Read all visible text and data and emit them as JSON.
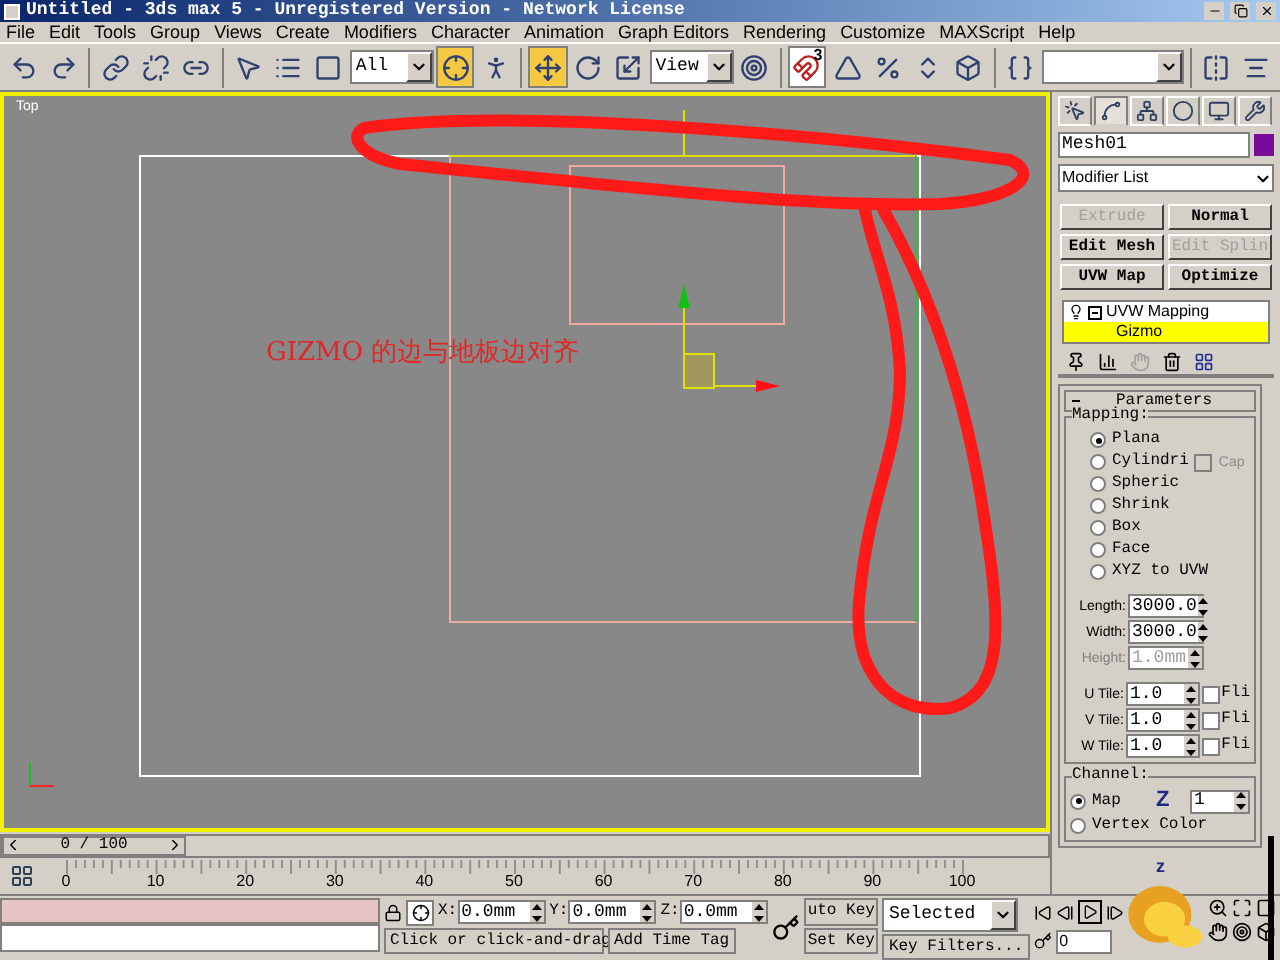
{
  "window": {
    "title": "Untitled - 3ds max 5 - Unregistered Version - Network License"
  },
  "menu": [
    "File",
    "Edit",
    "Tools",
    "Group",
    "Views",
    "Create",
    "Modifiers",
    "Character",
    "Animation",
    "Graph Editors",
    "Rendering",
    "Customize",
    "MAXScript",
    "Help"
  ],
  "toolbar": [
    {
      "kind": "button",
      "selected": false
    },
    {
      "kind": "button",
      "selected": false
    },
    {
      "kind": "sep"
    },
    {
      "kind": "button",
      "selected": false
    },
    {
      "kind": "button",
      "selected": false
    },
    {
      "kind": "button",
      "selected": false
    },
    {
      "kind": "sep"
    },
    {
      "kind": "button",
      "selected": false
    },
    {
      "kind": "button",
      "selected": false
    },
    {
      "kind": "button",
      "selected": false
    },
    {
      "kind": "dropdown",
      "value": "All"
    },
    {
      "kind": "button",
      "selected": true
    },
    {
      "kind": "button",
      "selected": false
    },
    {
      "kind": "sep"
    },
    {
      "kind": "button",
      "selected": true
    },
    {
      "kind": "button",
      "selected": false
    },
    {
      "kind": "button",
      "selected": false
    },
    {
      "kind": "dropdown",
      "value": "View"
    },
    {
      "kind": "button",
      "selected": false
    },
    {
      "kind": "sep"
    },
    {
      "kind": "button",
      "selected": true,
      "badge": "3"
    },
    {
      "kind": "button",
      "selected": false
    },
    {
      "kind": "button",
      "selected": false
    },
    {
      "kind": "button",
      "selected": false
    },
    {
      "kind": "button",
      "selected": false
    },
    {
      "kind": "sep"
    },
    {
      "kind": "button",
      "selected": false
    },
    {
      "kind": "dropdown"
    },
    {
      "kind": "sep"
    },
    {
      "kind": "button",
      "selected": false
    },
    {
      "kind": "button",
      "selected": false
    }
  ],
  "viewport": {
    "label": "Top",
    "annotation": "GIZMO 的边与地板边对齐"
  },
  "time_slider": {
    "position": "0 / 100",
    "level": 0
  },
  "ruler": [
    "0",
    "10",
    "20",
    "30",
    "40",
    "50",
    "60",
    "70",
    "80",
    "90",
    "100"
  ],
  "command_panel": {
    "tabs": [
      {
        "selected": false
      },
      {
        "selected": true
      },
      {
        "selected": false
      },
      {
        "selected": false
      },
      {
        "selected": false
      },
      {
        "selected": false
      }
    ],
    "object_name": "Mesh01",
    "modifier_list": "Modifier List",
    "modifier_buttons": [
      {
        "label": "Extrude",
        "disabled": true
      },
      {
        "label": "Normal",
        "disabled": false
      },
      {
        "label": "Edit Mesh",
        "disabled": false
      },
      {
        "label": "Edit Splin",
        "disabled": true
      },
      {
        "label": "UVW Map",
        "disabled": false
      },
      {
        "label": "Optimize",
        "disabled": false
      }
    ],
    "stack": [
      {
        "label": "UVW Mapping",
        "expanded": true,
        "selected": false,
        "children": [
          {
            "label": "Gizmo",
            "selected": true
          }
        ]
      }
    ],
    "parameters": {
      "title": "Parameters",
      "mapping_title": "Mapping:",
      "options": [
        {
          "label": "Plana",
          "selected": true
        },
        {
          "label": "Cylindri",
          "selected": false,
          "checkbox": {
            "label": "Cap",
            "checked": false,
            "disabled": true
          }
        },
        {
          "label": "Spheric",
          "selected": false
        },
        {
          "label": "Shrink",
          "selected": false
        },
        {
          "label": "Box",
          "selected": false
        },
        {
          "label": "Face",
          "selected": false
        },
        {
          "label": "XYZ to UVW",
          "selected": false
        }
      ],
      "spinners": [
        {
          "label": "Length:",
          "value": "3000.0",
          "disabled": false
        },
        {
          "label": "Width:",
          "value": "3000.0",
          "disabled": false
        },
        {
          "label": "Height:",
          "value": "1.0mm",
          "disabled": true
        }
      ],
      "tiles": [
        {
          "label": "U Tile:",
          "value": "1.0",
          "flip": "Fli",
          "checked": false
        },
        {
          "label": "V Tile:",
          "value": "1.0",
          "flip": "Fli",
          "checked": false
        },
        {
          "label": "W Tile:",
          "value": "1.0",
          "flip": "Fli",
          "checked": false
        }
      ],
      "channel_title": "Channel:",
      "channels": [
        {
          "label": "Map",
          "selected": true
        },
        {
          "label": "Vertex Color",
          "selected": false
        }
      ],
      "channel_value": "1"
    }
  },
  "status": {
    "coords": [
      {
        "label": "X:",
        "value": "0.0mm"
      },
      {
        "label": "Y:",
        "value": "0.0mm"
      },
      {
        "label": "Z:",
        "value": "0.0mm"
      }
    ],
    "prompt": "Click or click-and-drag",
    "add_time_tag": "Add Time Tag",
    "auto_key": "uto Key",
    "key_mode": "Selected",
    "set_key": "Set Key",
    "key_filters": "Key Filters...",
    "frame": "0"
  },
  "sleep_marks": [
    "Z",
    "z"
  ]
}
